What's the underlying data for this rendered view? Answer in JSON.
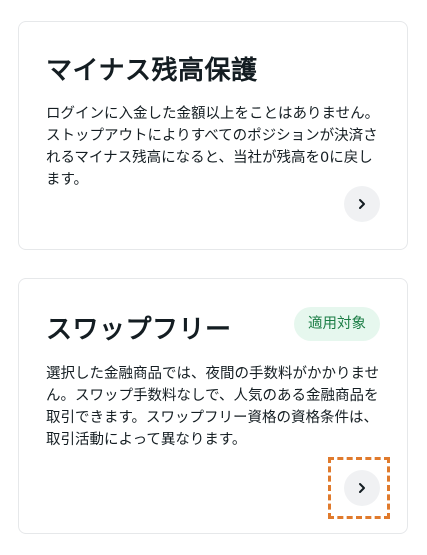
{
  "cards": [
    {
      "title": "マイナス残高保護",
      "description": "ログインに入金した金額以上をことはありません。ストップアウトによりすべてのポジションが決済されるマイナス残高になると、当社が残高を0に戻します。"
    },
    {
      "title": "スワップフリー",
      "badge": "適用対象",
      "description": "選択した金融商品では、夜間の手数料がかかりません。スワップ手数料なしで、人気のある金融商品を取引できます。スワップフリー資格の資格条件は、取引活動によって異なります。"
    }
  ],
  "colors": {
    "badge_bg": "#e6f7ee",
    "badge_text": "#1b7d45",
    "highlight": "#e07a2c"
  },
  "icons": {
    "arrow": "chevron-right-icon"
  }
}
